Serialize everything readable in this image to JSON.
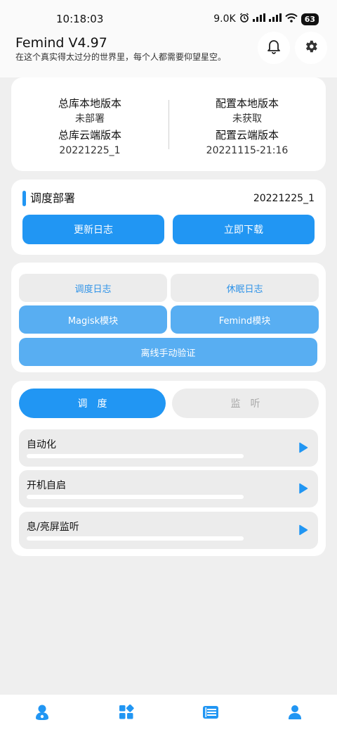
{
  "status_bar": {
    "time": "10:18:03",
    "net_speed": "9.0K",
    "battery": "63"
  },
  "header": {
    "title": "Femind V4.97",
    "subtitle": "在这个真实得太过分的世界里，每个人都需要仰望星空。",
    "bell_icon": "bell-icon",
    "gear_icon": "gear-icon"
  },
  "versions": {
    "total_local_label": "总库本地版本",
    "total_local_value": "未部署",
    "total_cloud_label": "总库云端版本",
    "total_cloud_value": "20221225_1",
    "config_local_label": "配置本地版本",
    "config_local_value": "未获取",
    "config_cloud_label": "配置云端版本",
    "config_cloud_value": "20221115-21:16"
  },
  "deploy": {
    "title": "调度部署",
    "version": "20221225_1",
    "update_log_button": "更新日志",
    "download_button": "立即下载"
  },
  "tools": {
    "schedule_log": "调度日志",
    "sleep_log": "休眠日志",
    "magisk_module": "Magisk模块",
    "femind_module": "Femind模块",
    "offline_verify": "离线手动验证"
  },
  "monitor": {
    "tabs": [
      {
        "label": "调度",
        "active": true
      },
      {
        "label": "监听",
        "active": false
      }
    ],
    "items": [
      {
        "label": "自动化"
      },
      {
        "label": "开机自启"
      },
      {
        "label": "息/亮屏监听"
      }
    ]
  },
  "bottom_nav": {
    "items": [
      "home-icon",
      "apps-icon",
      "list-icon",
      "profile-icon"
    ]
  },
  "colors": {
    "accent": "#2196f3",
    "accent_light": "#58aef2",
    "background": "#efefef"
  }
}
